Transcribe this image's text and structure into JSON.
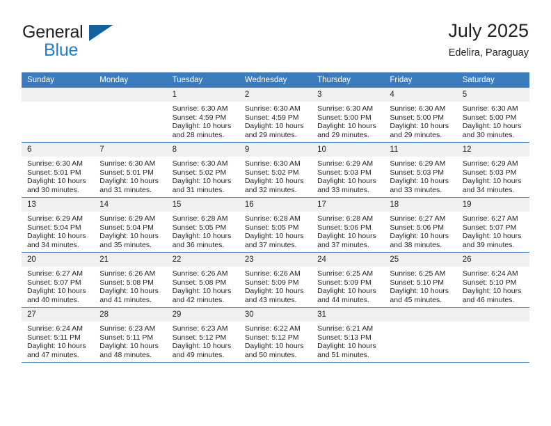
{
  "brand": {
    "name_part1": "General",
    "name_part2": "Blue",
    "triangle_icon": "brand-triangle-icon",
    "color_dark": "#231f20",
    "color_blue": "#1c7fd4",
    "color_triangle": "#14619f"
  },
  "header": {
    "title": "July 2025",
    "location": "Edelira, Paraguay"
  },
  "theme": {
    "header_blue": "#3b7cbe",
    "daynum_band": "#f0f0f0",
    "text": "#231f20"
  },
  "weekdays": [
    "Sunday",
    "Monday",
    "Tuesday",
    "Wednesday",
    "Thursday",
    "Friday",
    "Saturday"
  ],
  "weeks": [
    [
      {
        "day": "",
        "sunrise": "",
        "sunset": "",
        "daylight1": "",
        "daylight2": ""
      },
      {
        "day": "",
        "sunrise": "",
        "sunset": "",
        "daylight1": "",
        "daylight2": ""
      },
      {
        "day": "1",
        "sunrise": "Sunrise: 6:30 AM",
        "sunset": "Sunset: 4:59 PM",
        "daylight1": "Daylight: 10 hours",
        "daylight2": "and 28 minutes."
      },
      {
        "day": "2",
        "sunrise": "Sunrise: 6:30 AM",
        "sunset": "Sunset: 4:59 PM",
        "daylight1": "Daylight: 10 hours",
        "daylight2": "and 29 minutes."
      },
      {
        "day": "3",
        "sunrise": "Sunrise: 6:30 AM",
        "sunset": "Sunset: 5:00 PM",
        "daylight1": "Daylight: 10 hours",
        "daylight2": "and 29 minutes."
      },
      {
        "day": "4",
        "sunrise": "Sunrise: 6:30 AM",
        "sunset": "Sunset: 5:00 PM",
        "daylight1": "Daylight: 10 hours",
        "daylight2": "and 29 minutes."
      },
      {
        "day": "5",
        "sunrise": "Sunrise: 6:30 AM",
        "sunset": "Sunset: 5:00 PM",
        "daylight1": "Daylight: 10 hours",
        "daylight2": "and 30 minutes."
      }
    ],
    [
      {
        "day": "6",
        "sunrise": "Sunrise: 6:30 AM",
        "sunset": "Sunset: 5:01 PM",
        "daylight1": "Daylight: 10 hours",
        "daylight2": "and 30 minutes."
      },
      {
        "day": "7",
        "sunrise": "Sunrise: 6:30 AM",
        "sunset": "Sunset: 5:01 PM",
        "daylight1": "Daylight: 10 hours",
        "daylight2": "and 31 minutes."
      },
      {
        "day": "8",
        "sunrise": "Sunrise: 6:30 AM",
        "sunset": "Sunset: 5:02 PM",
        "daylight1": "Daylight: 10 hours",
        "daylight2": "and 31 minutes."
      },
      {
        "day": "9",
        "sunrise": "Sunrise: 6:30 AM",
        "sunset": "Sunset: 5:02 PM",
        "daylight1": "Daylight: 10 hours",
        "daylight2": "and 32 minutes."
      },
      {
        "day": "10",
        "sunrise": "Sunrise: 6:29 AM",
        "sunset": "Sunset: 5:03 PM",
        "daylight1": "Daylight: 10 hours",
        "daylight2": "and 33 minutes."
      },
      {
        "day": "11",
        "sunrise": "Sunrise: 6:29 AM",
        "sunset": "Sunset: 5:03 PM",
        "daylight1": "Daylight: 10 hours",
        "daylight2": "and 33 minutes."
      },
      {
        "day": "12",
        "sunrise": "Sunrise: 6:29 AM",
        "sunset": "Sunset: 5:03 PM",
        "daylight1": "Daylight: 10 hours",
        "daylight2": "and 34 minutes."
      }
    ],
    [
      {
        "day": "13",
        "sunrise": "Sunrise: 6:29 AM",
        "sunset": "Sunset: 5:04 PM",
        "daylight1": "Daylight: 10 hours",
        "daylight2": "and 34 minutes."
      },
      {
        "day": "14",
        "sunrise": "Sunrise: 6:29 AM",
        "sunset": "Sunset: 5:04 PM",
        "daylight1": "Daylight: 10 hours",
        "daylight2": "and 35 minutes."
      },
      {
        "day": "15",
        "sunrise": "Sunrise: 6:28 AM",
        "sunset": "Sunset: 5:05 PM",
        "daylight1": "Daylight: 10 hours",
        "daylight2": "and 36 minutes."
      },
      {
        "day": "16",
        "sunrise": "Sunrise: 6:28 AM",
        "sunset": "Sunset: 5:05 PM",
        "daylight1": "Daylight: 10 hours",
        "daylight2": "and 37 minutes."
      },
      {
        "day": "17",
        "sunrise": "Sunrise: 6:28 AM",
        "sunset": "Sunset: 5:06 PM",
        "daylight1": "Daylight: 10 hours",
        "daylight2": "and 37 minutes."
      },
      {
        "day": "18",
        "sunrise": "Sunrise: 6:27 AM",
        "sunset": "Sunset: 5:06 PM",
        "daylight1": "Daylight: 10 hours",
        "daylight2": "and 38 minutes."
      },
      {
        "day": "19",
        "sunrise": "Sunrise: 6:27 AM",
        "sunset": "Sunset: 5:07 PM",
        "daylight1": "Daylight: 10 hours",
        "daylight2": "and 39 minutes."
      }
    ],
    [
      {
        "day": "20",
        "sunrise": "Sunrise: 6:27 AM",
        "sunset": "Sunset: 5:07 PM",
        "daylight1": "Daylight: 10 hours",
        "daylight2": "and 40 minutes."
      },
      {
        "day": "21",
        "sunrise": "Sunrise: 6:26 AM",
        "sunset": "Sunset: 5:08 PM",
        "daylight1": "Daylight: 10 hours",
        "daylight2": "and 41 minutes."
      },
      {
        "day": "22",
        "sunrise": "Sunrise: 6:26 AM",
        "sunset": "Sunset: 5:08 PM",
        "daylight1": "Daylight: 10 hours",
        "daylight2": "and 42 minutes."
      },
      {
        "day": "23",
        "sunrise": "Sunrise: 6:26 AM",
        "sunset": "Sunset: 5:09 PM",
        "daylight1": "Daylight: 10 hours",
        "daylight2": "and 43 minutes."
      },
      {
        "day": "24",
        "sunrise": "Sunrise: 6:25 AM",
        "sunset": "Sunset: 5:09 PM",
        "daylight1": "Daylight: 10 hours",
        "daylight2": "and 44 minutes."
      },
      {
        "day": "25",
        "sunrise": "Sunrise: 6:25 AM",
        "sunset": "Sunset: 5:10 PM",
        "daylight1": "Daylight: 10 hours",
        "daylight2": "and 45 minutes."
      },
      {
        "day": "26",
        "sunrise": "Sunrise: 6:24 AM",
        "sunset": "Sunset: 5:10 PM",
        "daylight1": "Daylight: 10 hours",
        "daylight2": "and 46 minutes."
      }
    ],
    [
      {
        "day": "27",
        "sunrise": "Sunrise: 6:24 AM",
        "sunset": "Sunset: 5:11 PM",
        "daylight1": "Daylight: 10 hours",
        "daylight2": "and 47 minutes."
      },
      {
        "day": "28",
        "sunrise": "Sunrise: 6:23 AM",
        "sunset": "Sunset: 5:11 PM",
        "daylight1": "Daylight: 10 hours",
        "daylight2": "and 48 minutes."
      },
      {
        "day": "29",
        "sunrise": "Sunrise: 6:23 AM",
        "sunset": "Sunset: 5:12 PM",
        "daylight1": "Daylight: 10 hours",
        "daylight2": "and 49 minutes."
      },
      {
        "day": "30",
        "sunrise": "Sunrise: 6:22 AM",
        "sunset": "Sunset: 5:12 PM",
        "daylight1": "Daylight: 10 hours",
        "daylight2": "and 50 minutes."
      },
      {
        "day": "31",
        "sunrise": "Sunrise: 6:21 AM",
        "sunset": "Sunset: 5:13 PM",
        "daylight1": "Daylight: 10 hours",
        "daylight2": "and 51 minutes."
      },
      {
        "day": "",
        "sunrise": "",
        "sunset": "",
        "daylight1": "",
        "daylight2": ""
      },
      {
        "day": "",
        "sunrise": "",
        "sunset": "",
        "daylight1": "",
        "daylight2": ""
      }
    ]
  ]
}
